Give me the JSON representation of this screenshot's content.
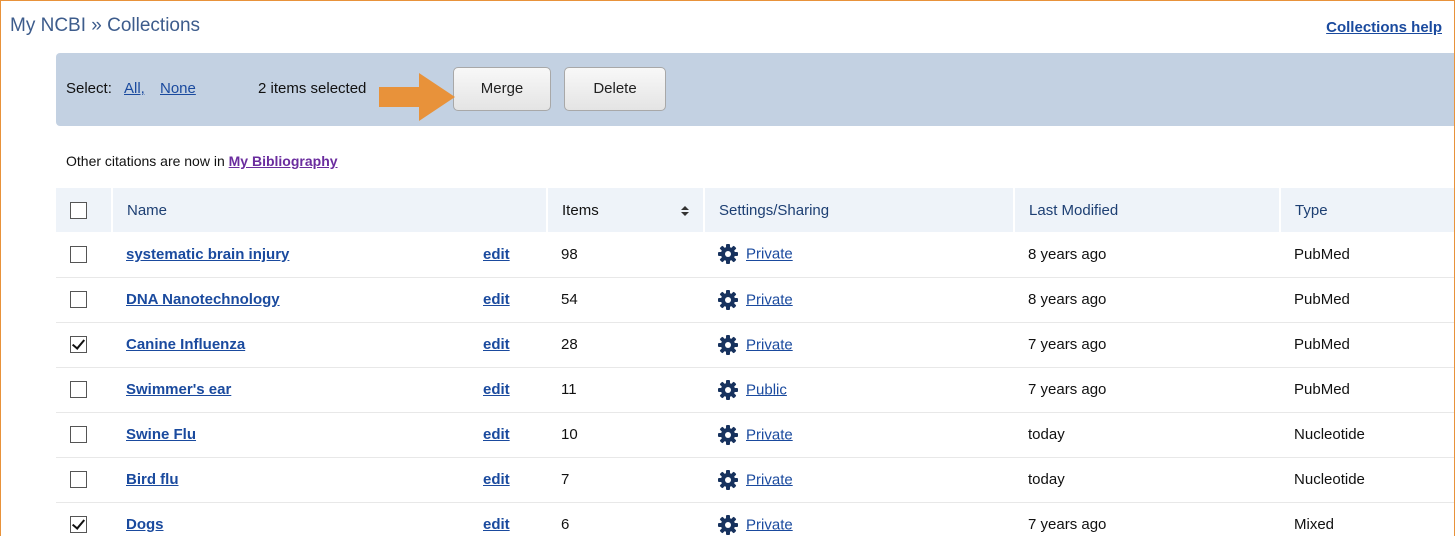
{
  "header": {
    "prefix": "My NCBI",
    "separator": " » ",
    "title": "Collections",
    "help_link": "Collections help"
  },
  "toolbar": {
    "select_label": "Select:",
    "all_link": "All,",
    "none_link": "None",
    "selected_count": "2 items selected",
    "merge_label": "Merge",
    "delete_label": "Delete"
  },
  "notice": {
    "text": "Other citations are now in ",
    "link": "My Bibliography"
  },
  "table": {
    "columns": [
      "Name",
      "Items",
      "Settings/Sharing",
      "Last Modified",
      "Type"
    ],
    "edit_label": "edit",
    "rows": [
      {
        "checked": false,
        "name": "systematic brain injury",
        "items": "98",
        "sharing": "Private",
        "modified": "8 years ago",
        "type": "PubMed"
      },
      {
        "checked": false,
        "name": "DNA Nanotechnology",
        "items": "54",
        "sharing": "Private",
        "modified": "8 years ago",
        "type": "PubMed"
      },
      {
        "checked": true,
        "name": "Canine Influenza",
        "items": "28",
        "sharing": "Private",
        "modified": "7 years ago",
        "type": "PubMed"
      },
      {
        "checked": false,
        "name": "Swimmer's ear",
        "items": "11",
        "sharing": "Public",
        "modified": "7 years ago",
        "type": "PubMed"
      },
      {
        "checked": false,
        "name": "Swine Flu",
        "items": "10",
        "sharing": "Private",
        "modified": "today",
        "type": "Nucleotide"
      },
      {
        "checked": false,
        "name": "Bird flu",
        "items": "7",
        "sharing": "Private",
        "modified": "today",
        "type": "Nucleotide"
      },
      {
        "checked": true,
        "name": "Dogs",
        "items": "6",
        "sharing": "Private",
        "modified": "7 years ago",
        "type": "Mixed"
      }
    ]
  },
  "icons": {
    "gear": "gear-icon",
    "sort": "sort-icon",
    "pointer_arrow": "pointer-arrow-icon"
  },
  "colors": {
    "accent_orange": "#e8923a",
    "toolbar_bg": "#c3d1e2",
    "link_blue": "#1a4a9e",
    "link_purple": "#6a2c9e",
    "header_blue": "#3d5c8c"
  }
}
